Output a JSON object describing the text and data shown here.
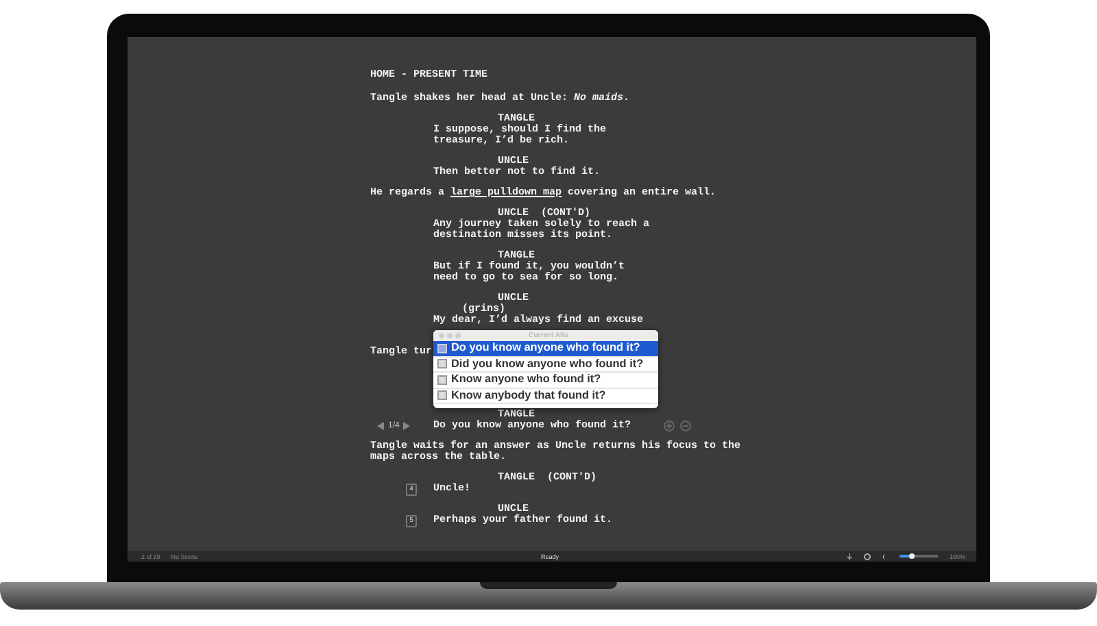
{
  "script": [
    {
      "kind": "scene",
      "lines": [
        "HOME - PRESENT TIME"
      ]
    },
    {
      "kind": "action",
      "lines": [
        [
          {
            "text": "Tangle shakes her head at Uncle: *No maids*."
          }
        ]
      ]
    },
    {
      "kind": "character",
      "lines": [
        "TANGLE"
      ]
    },
    {
      "kind": "dialogue",
      "lines": [
        "I suppose, should I find the",
        "treasure, I’d be rich."
      ]
    },
    {
      "kind": "character",
      "lines": [
        "UNCLE"
      ]
    },
    {
      "kind": "dialogue",
      "lines": [
        "Then better not to find it."
      ]
    },
    {
      "kind": "action",
      "lines": [
        [
          {
            "text": "He regards a "
          },
          {
            "text": "large pulldown map",
            "underlined": true
          },
          {
            "text": " covering an entire wall."
          }
        ]
      ]
    },
    {
      "kind": "character",
      "lines": [
        "UNCLE  (CONT'D)"
      ]
    },
    {
      "kind": "dialogue",
      "lines": [
        "Any journey taken solely to reach a",
        "destination misses its point."
      ]
    },
    {
      "kind": "character",
      "lines": [
        "TANGLE"
      ]
    },
    {
      "kind": "dialogue",
      "lines": [
        "But if I found it, you wouldn’t",
        "need to go to sea for so long."
      ]
    },
    {
      "kind": "character",
      "lines": [
        "UNCLE"
      ]
    },
    {
      "kind": "parenthetical",
      "lines": [
        "(grins)"
      ]
    },
    {
      "kind": "dialogue",
      "lines": [
        "My dear, I’d always find an excuse"
      ]
    },
    {
      "kind": "action",
      "lines": [
        [
          {
            "text": "Tangle tur"
          }
        ]
      ]
    },
    {
      "kind": "character",
      "lines": [
        "TANGLE"
      ]
    },
    {
      "kind": "dialogue",
      "lines": [
        "Do you know anyone who found it?"
      ],
      "alt_counter": "1/4"
    },
    {
      "kind": "action",
      "lines": [
        [
          {
            "text": "Tangle waits for an answer as Uncle returns his focus to the"
          }
        ],
        [
          {
            "text": "maps across the table."
          }
        ]
      ]
    },
    {
      "kind": "character",
      "lines": [
        "TANGLE  (CONT'D)"
      ]
    },
    {
      "kind": "dialogue",
      "lines": [
        "Uncle!"
      ],
      "line_number": "4"
    },
    {
      "kind": "character",
      "lines": [
        "UNCLE"
      ]
    },
    {
      "kind": "dialogue",
      "lines": [
        "Perhaps your father found it."
      ],
      "line_number": "5"
    }
  ],
  "alts_popup": {
    "title": "Current Alts",
    "items": [
      {
        "text": "Do you know anyone who found it?",
        "selected": true
      },
      {
        "text": "Did you know anyone who found it?",
        "selected": false
      },
      {
        "text": "Know anyone who found it?",
        "selected": false
      },
      {
        "text": "Know anybody that found it?",
        "selected": false
      }
    ]
  },
  "status_bar": {
    "page": "2 of 29",
    "scene": "No Scene",
    "status": "Ready",
    "zoom": {
      "level": 0.3,
      "reading": "100%"
    }
  }
}
